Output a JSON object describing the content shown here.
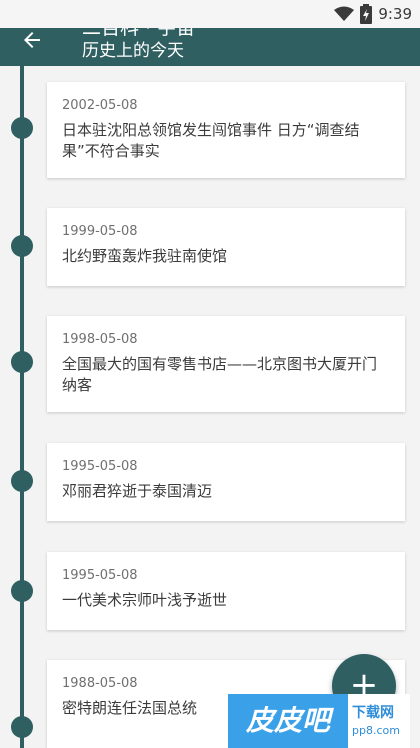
{
  "status_bar": {
    "time": "9:39",
    "icons": [
      "wifi-icon",
      "battery-charging-icon"
    ]
  },
  "app_bar": {
    "back_icon": "arrow-left-icon",
    "title_top": "二百科 · 宇宙",
    "title": "历史上的今天",
    "color": "#2f5f61"
  },
  "events": [
    {
      "date": "2002-05-08",
      "text": "日本驻沈阳总领馆发生闯馆事件 日方“调查结果”不符合事实"
    },
    {
      "date": "1999-05-08",
      "text": "北约野蛮轰炸我驻南使馆"
    },
    {
      "date": "1998-05-08",
      "text": "全国最大的国有零售书店——北京图书大厦开门纳客"
    },
    {
      "date": "1995-05-08",
      "text": "邓丽君猝逝于泰国清迈"
    },
    {
      "date": "1995-05-08",
      "text": "一代美术宗师叶浅予逝世"
    },
    {
      "date": "1988-05-08",
      "text": "密特朗连任法国总统"
    }
  ],
  "fab": {
    "label": "+",
    "icon": "plus-icon"
  },
  "watermark": {
    "logo_text": "皮皮吧",
    "side_top": "下载网",
    "side_bottom": "pp8.com"
  }
}
